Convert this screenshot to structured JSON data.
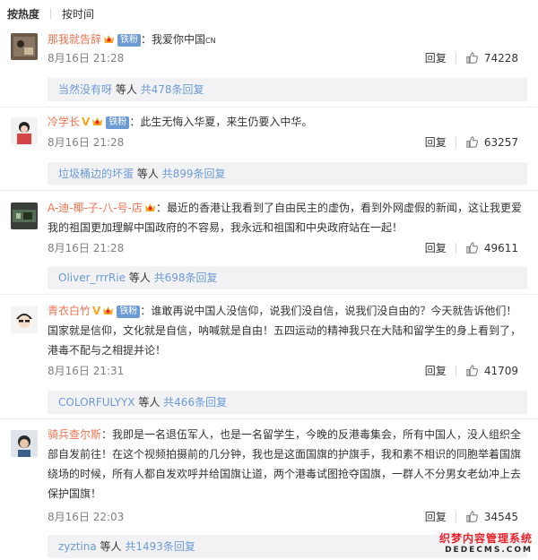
{
  "sort": {
    "hot": "按热度",
    "time": "按时间"
  },
  "comments": [
    {
      "user": "那我就告辞",
      "has_v": false,
      "text": "：我爱你中国",
      "tag": "CN",
      "date": "8月16日 21:28",
      "reply": "回复",
      "likes": "74228",
      "sub_user": "当然没有呀",
      "sub_mid": " 等人 ",
      "sub_more": "共478条回复"
    },
    {
      "user": "冷学长",
      "has_v": true,
      "text": "：此生无悔入华夏，来生仍要入中华。",
      "date": "8月16日 21:28",
      "reply": "回复",
      "likes": "63257",
      "sub_user": "垃圾桶边的坏蛋",
      "sub_mid": " 等人 ",
      "sub_more": "共899条回复"
    },
    {
      "user": "A-迪-椰-子-八-号-店",
      "has_v": false,
      "text": "：最近的香港让我看到了自由民主的虚伪，看到外网虚假的新闻，这让我更爱我的祖国更加理解中国政府的不容易，我永远和祖国和中央政府站在一起！",
      "date": "8月16日 21:28",
      "reply": "回复",
      "likes": "49611",
      "sub_user": "Oliver_rrrRie",
      "sub_mid": " 等人 ",
      "sub_more": "共698条回复"
    },
    {
      "user": "青衣白竹",
      "has_v": true,
      "text": "：谁敢再说中国人没信仰，说我们没自信，说我们没自由的？今天就告诉他们！国家就是信仰，文化就是自信，呐喊就是自由！五四运动的精神我只在大陆和留学生的身上看到了，港毒不配与之相提并论！",
      "date": "8月16日 21:31",
      "reply": "回复",
      "likes": "41709",
      "sub_user": "COLORFULYYX",
      "sub_mid": " 等人 ",
      "sub_more": "共466条回复"
    },
    {
      "user": "骑兵查尔斯",
      "has_v": false,
      "text": "：我即是一名退伍军人，也是一名留学生，今晚的反港毒集会，所有中国人，没人组织全部自发前往！在这个视频拍摄前的几分钟，我也是这面国旗的护旗手，我和素不相识的同胞举着国旗绕场的时候，所有人都自发欢呼并给国旗让道，两个港毒试图抢夺国旗，一群人不分男女老幼冲上去保护国旗！",
      "date": "8月16日 22:03",
      "reply": "回复",
      "likes": "34545",
      "sub_user": "zyztina",
      "sub_mid": " 等人 ",
      "sub_more": "共1493条回复"
    }
  ],
  "badge_fan": "铁粉",
  "badge_v": "V",
  "watermark": {
    "top": "织梦内容管理系统",
    "bottom": "DEDECMS.COM"
  }
}
